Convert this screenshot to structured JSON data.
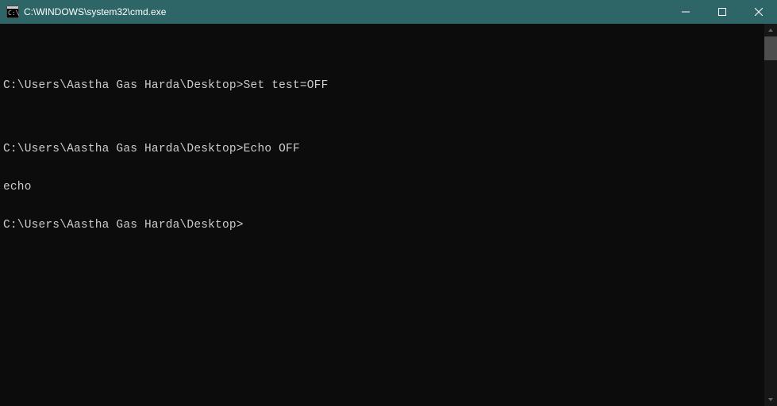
{
  "titlebar": {
    "title": "C:\\WINDOWS\\system32\\cmd.exe"
  },
  "terminal": {
    "lines": [
      "",
      "C:\\Users\\Aastha Gas Harda\\Desktop>Set test=OFF",
      "",
      "C:\\Users\\Aastha Gas Harda\\Desktop>Echo OFF",
      "echo",
      "C:\\Users\\Aastha Gas Harda\\Desktop>"
    ]
  }
}
